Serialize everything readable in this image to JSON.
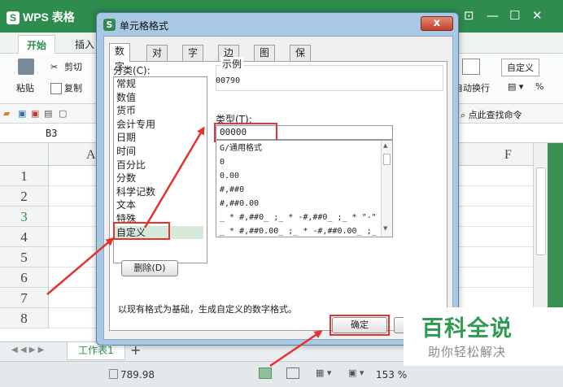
{
  "app": {
    "title": "WPS 表格",
    "logo_letter": "S"
  },
  "ribbon": {
    "tabs": [
      "开始",
      "插入"
    ],
    "cut": "剪切",
    "copy": "复制",
    "paste": "粘贴",
    "right_group": "自定义",
    "wrap": "自动换行",
    "percent": "%",
    "search_cmd": "点此查找命令"
  },
  "sheet": {
    "cell_ref": "B3",
    "columns": [
      "A",
      "F"
    ],
    "rows": [
      "1",
      "2",
      "3",
      "4",
      "5",
      "6",
      "7",
      "8"
    ],
    "tab": "工作表1",
    "add_sheet": "+",
    "sum_value": "789.98",
    "zoom": "153 %"
  },
  "dialog": {
    "logo_letter": "S",
    "title": "单元格格式",
    "close": "x",
    "tabs": [
      "数字",
      "对齐",
      "字体",
      "边框",
      "图案",
      "保护"
    ],
    "category_label": "分类(C):",
    "categories": [
      "常规",
      "数值",
      "货币",
      "会计专用",
      "日期",
      "时间",
      "百分比",
      "分数",
      "科学记数",
      "文本",
      "特殊",
      "自定义"
    ],
    "sample_label": "示例",
    "sample_value": "00790",
    "type_label": "类型(T):",
    "type_value": "00000",
    "formats": [
      "G/通用格式",
      "0",
      "0.00",
      "#,##0",
      "#,##0.00",
      "_ * #,##0_ ;_ * -#,##0_ ;_ * \"-\"",
      "_ * #,##0.00_ ;_ * -#,##0.00_ ;_"
    ],
    "delete_button": "删除(D)",
    "description": "以现有格式为基础，生成自定义的数字格式。",
    "ok_button": "确定"
  },
  "watermark": {
    "main": "百科全说",
    "sub": "助你轻松解决"
  }
}
